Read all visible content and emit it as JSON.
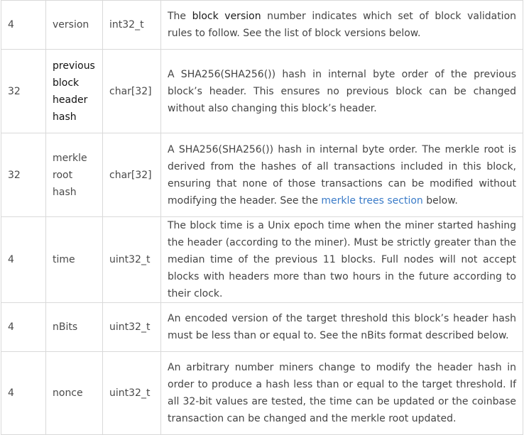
{
  "rows": [
    {
      "bytes": "4",
      "name_lines": [
        "version"
      ],
      "type": "int32_t",
      "desc": {
        "pre": "The ",
        "emph": "block version",
        "post": " number indicates which set of block validation rules to follow. See the list of block versions below."
      }
    },
    {
      "bytes": "32",
      "name_lines": [
        "previous",
        "block",
        "header",
        "hash"
      ],
      "type": "char[32]",
      "desc": {
        "text": "A SHA256(SHA256()) hash in internal byte order of the previous block’s header. This ensures no previous block can be changed without also changing this block’s header."
      }
    },
    {
      "bytes": "32",
      "name_lines": [
        "merkle",
        "root",
        "hash"
      ],
      "type": "char[32]",
      "desc": {
        "pre": "A SHA256(SHA256()) hash in internal byte order. The merkle root is derived from the hashes of all transactions included in this block, ensuring that none of those transactions can be modified without modifying the header. See the ",
        "link": "merkle trees section",
        "post": " below."
      }
    },
    {
      "bytes": "4",
      "name_lines": [
        "time"
      ],
      "type": "uint32_t",
      "desc": {
        "text": "The block time is a Unix epoch time when the miner started hashing the header (according to the miner). Must be strictly greater than the median time of the previous 11 blocks. Full nodes will not accept blocks with headers more than two hours in the future according to their clock."
      }
    },
    {
      "bytes": "4",
      "name_lines": [
        "nBits"
      ],
      "type": "uint32_t",
      "desc": {
        "text": "An encoded version of the target threshold this block’s header hash must be less than or equal to. See the nBits format described below."
      }
    },
    {
      "bytes": "4",
      "name_lines": [
        "nonce"
      ],
      "type": "uint32_t",
      "desc": {
        "text": "An arbitrary number miners change to modify the header hash in order to produce a hash less than or equal to the target threshold. If all 32-bit values are tested, the time can be updated or the coinbase transaction can be changed and the merkle root updated."
      }
    }
  ]
}
